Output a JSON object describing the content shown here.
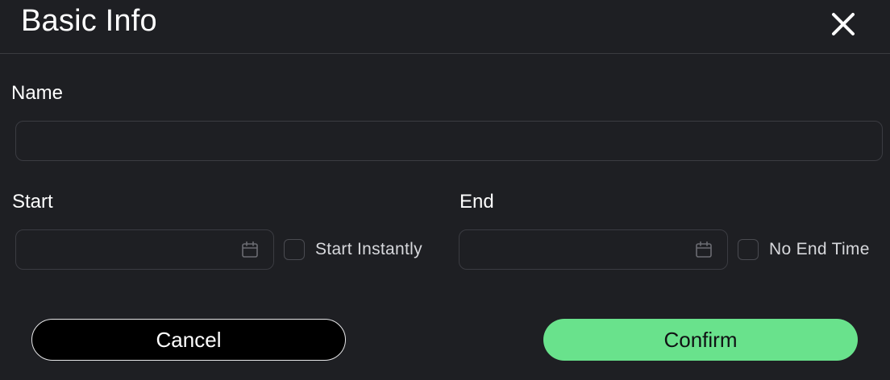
{
  "dialog": {
    "title": "Basic Info",
    "close_icon": "close-icon"
  },
  "form": {
    "name": {
      "label": "Name",
      "value": "",
      "placeholder": ""
    },
    "start": {
      "label": "Start",
      "value": "",
      "placeholder": "",
      "icon": "calendar-icon",
      "checkbox_label": "Start Instantly",
      "checked": false
    },
    "end": {
      "label": "End",
      "value": "",
      "placeholder": "",
      "icon": "calendar-icon",
      "checkbox_label": "No End Time",
      "checked": false
    }
  },
  "actions": {
    "cancel_label": "Cancel",
    "confirm_label": "Confirm"
  },
  "colors": {
    "background": "#1e1f23",
    "accent": "#69e28c",
    "border": "#3b3c42"
  }
}
